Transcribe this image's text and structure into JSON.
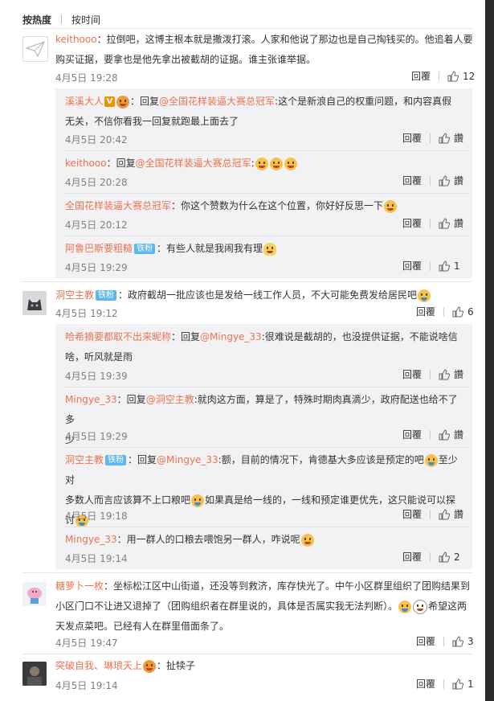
{
  "sort": {
    "hot": "按热度",
    "time": "按时间"
  },
  "labels": {
    "reply": "回覆",
    "like_zan": "讚"
  },
  "comments": [
    {
      "user": "keithooo",
      "text1": "：拉倒吧，这博主根本就是撒泼打滚。人家和他说了那边也是自己掏钱买的。他追着人要",
      "text2": "购买证据，要拿也是他先拿出被截胡的证据。谁主张谁举据。",
      "time": "4月5日 19:28",
      "likes": "12",
      "replies": [
        {
          "user": "溪溪大人",
          "reply_to": "@全国花样装逼大赛总冠军",
          "text1": ":这个是新浪自己的权重问题，和内容真假",
          "text2": "无关，不信你看我一回复就跑最上面去了",
          "time": "4月5日 20:42",
          "likes": "讚"
        },
        {
          "user": "keithooo",
          "reply_to": "@全国花样装逼大赛总冠军",
          "text1": ":",
          "time": "4月5日 20:28",
          "likes": "讚"
        },
        {
          "user": "全国花样装逼大赛总冠军",
          "text1": "：你这个赞数为什么在这个位置，你好好反思一下",
          "time": "4月5日 20:12",
          "likes": "讚"
        },
        {
          "user": "阿鲁巴斯要粗糙",
          "badge": "铁粉",
          "text1": "：有些人就是我闹我有理",
          "time": "4月5日 19:29",
          "likes": "1"
        }
      ]
    },
    {
      "user": "洞空主教",
      "badge": "铁粉",
      "text1": "：政府截胡一批应该也是发给一线工作人员，不大可能免费发给居民吧",
      "time": "4月5日 19:12",
      "likes": "6",
      "replies": [
        {
          "user": "哈希摘要都取不出来昵称",
          "reply_to": "@Mingye_33",
          "text1": ":很难说是截胡的，也没提供证据，不能说啥信",
          "text2": "啥，听风就是雨",
          "time": "4月5日 19:39",
          "likes": "讚"
        },
        {
          "user": "Mingye_33",
          "reply_to": "@洞空主教",
          "text1": ":就肉这方面，算是了，特殊时期肉真滴少，政府配送也给不了多",
          "text2": "少",
          "time": "4月5日 19:29",
          "likes": "讚"
        },
        {
          "user": "洞空主教",
          "badge": "铁粉",
          "reply_to": "@Mingye_33",
          "text1": ":额，目前的情况下，肯德基大多应该是预定的吧",
          "text1b": "至少对",
          "text2": "多数人而言应该算不上口粮吧",
          "text2b": "如果真是给一线的，一线和预定谁更优先，这只能说可以探",
          "text3": "讨",
          "time": "4月5日 19:18",
          "likes": "讚"
        },
        {
          "user": "Mingye_33",
          "text1": "：用一群人的口粮去喂饱另一群人，咋说呢",
          "time": "4月5日 19:14",
          "likes": "2"
        }
      ]
    },
    {
      "user": "糖萝卜一枚",
      "text1": "：坐标松江区中山街道，还没等到救济，库存快光了。中午小区群里组织了团购结果到",
      "text2": "小区门口不让进又退掉了（团购组织者在群里说的，具体是否属实我无法判断）。",
      "text2b": "希望这两",
      "text3": "天发点菜吧。已经有人在群里借面条了。",
      "time": "4月5日 19:47",
      "likes": "3"
    },
    {
      "user": "突破自我、琳琅天上",
      "text1": "：扯犊子",
      "time": "4月5日 19:14",
      "likes": "1"
    }
  ],
  "colors": {
    "name": "#eb7350",
    "meta": "#808080",
    "sub_bg": "#f2f2f5",
    "badge": "#5cb8f0"
  }
}
